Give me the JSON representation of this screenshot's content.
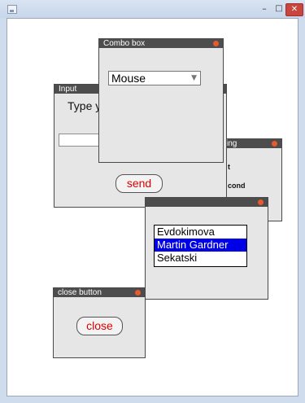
{
  "window": {
    "minimize_glyph": "–",
    "maximize_glyph": "□",
    "close_glyph": "✕"
  },
  "frames": {
    "input": {
      "title": "Input",
      "prompt": "Type y",
      "text_value": "",
      "send_label": "send"
    },
    "hidden_right": {
      "title": "ing",
      "text_a": "t",
      "text_b": "cond"
    },
    "combo": {
      "title": "Combo box",
      "selected": "Mouse"
    },
    "list": {
      "items": [
        "Evdokimova",
        "Martin Gardner",
        "Sekatski"
      ],
      "selected_index": 1
    },
    "close_button_frame": {
      "title": "close button",
      "button_label": "close"
    }
  },
  "colors": {
    "title_bar": "#4d4d4d",
    "frame_bg": "#e6e6e6",
    "dot": "#e8592b",
    "button_text": "#dd0000",
    "selection": "#0000e6"
  }
}
